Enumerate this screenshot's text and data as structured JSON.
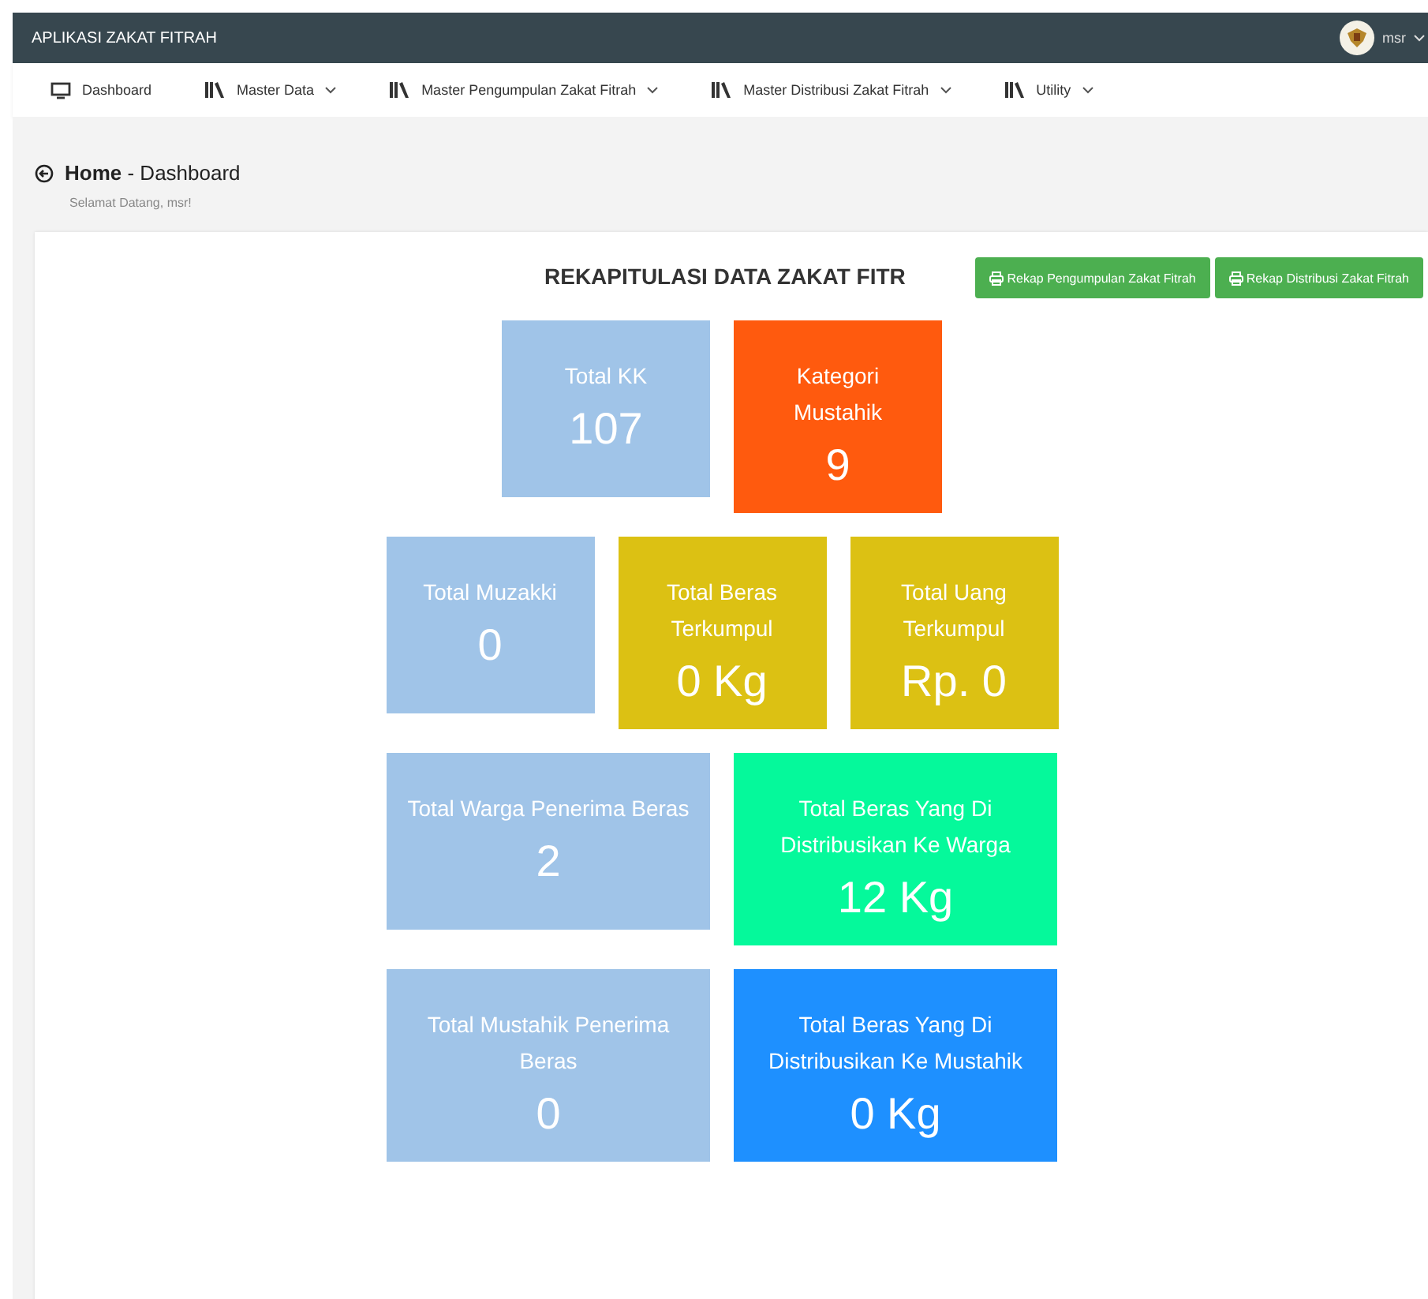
{
  "app_title": "APLIKASI ZAKAT FITRAH",
  "user": {
    "name": "msr"
  },
  "nav": [
    {
      "label": "Dashboard",
      "kind": "monitor",
      "dropdown": false
    },
    {
      "label": "Master Data",
      "kind": "books",
      "dropdown": true
    },
    {
      "label": "Master Pengumpulan Zakat Fitrah",
      "kind": "books",
      "dropdown": true
    },
    {
      "label": "Master Distribusi Zakat Fitrah",
      "kind": "books",
      "dropdown": true
    },
    {
      "label": "Utility",
      "kind": "books",
      "dropdown": true
    }
  ],
  "breadcrumb": {
    "title": "**Home** - Dashboard",
    "subtitle": "Selamat Datang, msr!"
  },
  "report": {
    "title": "REKAPITULASI DATA ZAKAT FITR",
    "buttons": [
      "Rekap Pengumpulan Zakat Fitrah",
      "Rekap Distribusi Zakat Fitrah"
    ]
  },
  "tile_rows": [
    [
      {
        "label": "Total KK",
        "value": "107",
        "color": "#a0c4e8",
        "kind": "small"
      },
      {
        "label": "Kategori Mustahik",
        "value": "9",
        "color": "#ff5a0e",
        "kind": "small"
      }
    ],
    [
      {
        "label": "Total Muzakki",
        "value": "0",
        "color": "#a0c4e8",
        "kind": "small"
      },
      {
        "label": "Total Beras Terkumpul",
        "value": "0 Kg",
        "color": "#dcc113",
        "kind": "small"
      },
      {
        "label": "Total Uang Terkumpul",
        "value": "Rp. 0",
        "color": "#dcc113",
        "kind": "small"
      }
    ],
    [
      {
        "label": "Total Warga Penerima Beras",
        "value": "2",
        "color": "#a0c4e8",
        "kind": "wide"
      },
      {
        "label": "Total Beras Yang Di Distribusikan Ke Warga",
        "value": "12 Kg",
        "color": "#05f99b",
        "kind": "wide"
      }
    ],
    [
      {
        "label": "Total Mustahik Penerima Beras",
        "value": "0",
        "color": "#a0c4e8",
        "kind": "wide"
      },
      {
        "label": "Total Beras Yang Di Distribusikan Ke Mustahik",
        "value": "0 Kg",
        "color": "#1e90ff",
        "kind": "wide"
      }
    ]
  ]
}
